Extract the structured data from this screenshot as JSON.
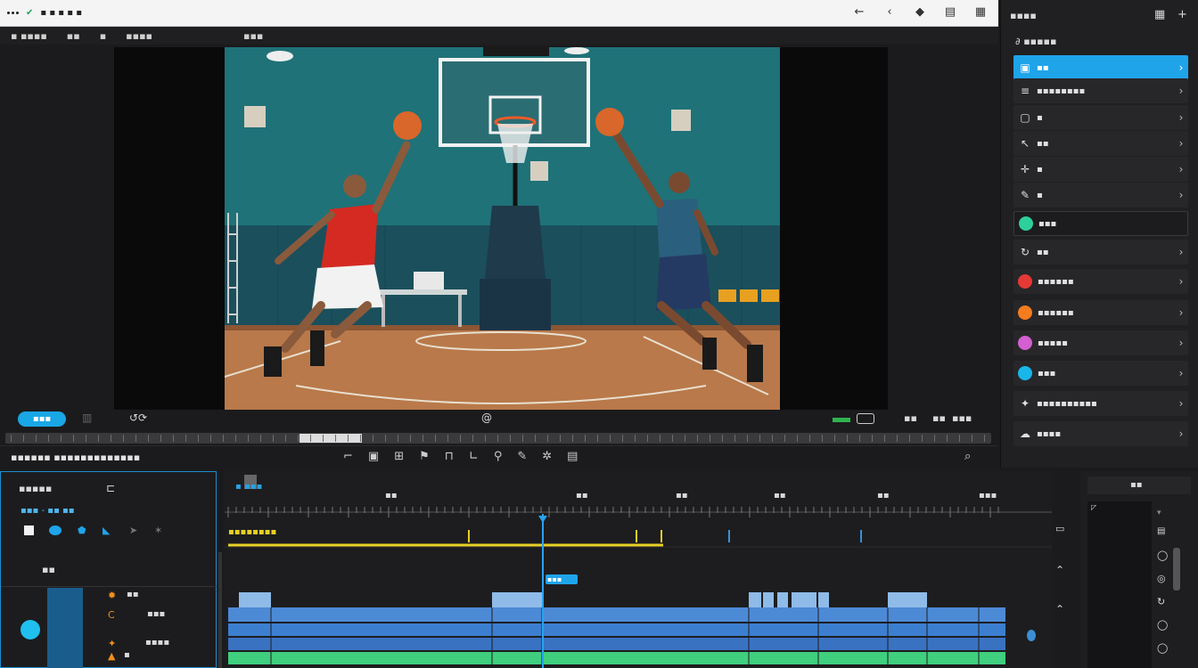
{
  "window": {
    "app_title": "▪ ▪ ▪ ▪ ▪",
    "title_right_icons": [
      "arrow-left-icon",
      "back-icon",
      "shield-icon",
      "panel-icon",
      "grid-icon"
    ]
  },
  "menu": [
    "▪ ▪▪▪▪",
    "▪▪",
    "▪",
    "▪▪▪▪",
    "▪▪▪"
  ],
  "viewer": {
    "play_label": "▪▪▪",
    "center_icon": "@",
    "right_tools": [
      "▪▪",
      "▪▪",
      "▪▪▪"
    ]
  },
  "infobar": {
    "text": "▪▪▪▪▪▪ ▪▪▪▪▪▪▪▪▪▪▪▪▪"
  },
  "right_panel": {
    "title": "▪▪▪▪",
    "subtitle": "▪▪▪▪▪",
    "items": [
      {
        "label": "▪▪",
        "icon": "▣",
        "active": true
      },
      {
        "label": "▪▪▪▪▪▪▪▪",
        "icon": "≡"
      },
      {
        "label": "▪",
        "icon": "▢"
      },
      {
        "label": "▪▪",
        "icon": "↖"
      },
      {
        "label": "▪",
        "icon": "✛"
      },
      {
        "label": "▪",
        "icon": "✎"
      },
      {
        "label": "▪▪▪",
        "icon": "●",
        "boxed": true,
        "color": "#2ed09a"
      },
      {
        "label": "▪▪",
        "icon": "↻"
      },
      {
        "label": "▪▪▪▪▪▪",
        "icon": "●",
        "color": "#e53935"
      },
      {
        "label": "▪▪▪▪▪▪",
        "icon": "●",
        "color": "#f57c1f"
      },
      {
        "label": "▪▪▪▪▪",
        "icon": "●",
        "color": "#d35fd0"
      },
      {
        "label": "▪▪▪",
        "icon": "●",
        "color": "#19b6ea"
      },
      {
        "label": "▪▪▪▪▪▪▪▪▪▪",
        "icon": "✦"
      },
      {
        "label": "▪▪▪▪",
        "icon": "☁"
      }
    ]
  },
  "left_panel": {
    "title": "▪▪▪▪▪",
    "subtitle": "▪▪▪ - ▪▪ ▪▪",
    "section": "▪▪",
    "rows": [
      "▪▪",
      "▪▪▪",
      "▪▪▪▪",
      "▪"
    ]
  },
  "timeline": {
    "track_label": "▪▪▪▪▪▪▪▪",
    "ruler_labels": [
      "▪▪",
      "▪▪",
      "▪▪",
      "▪▪",
      "▪▪",
      "▪▪▪"
    ],
    "marker_label": "▪▪▪"
  },
  "bottom_right": {
    "title": "▪▪"
  }
}
